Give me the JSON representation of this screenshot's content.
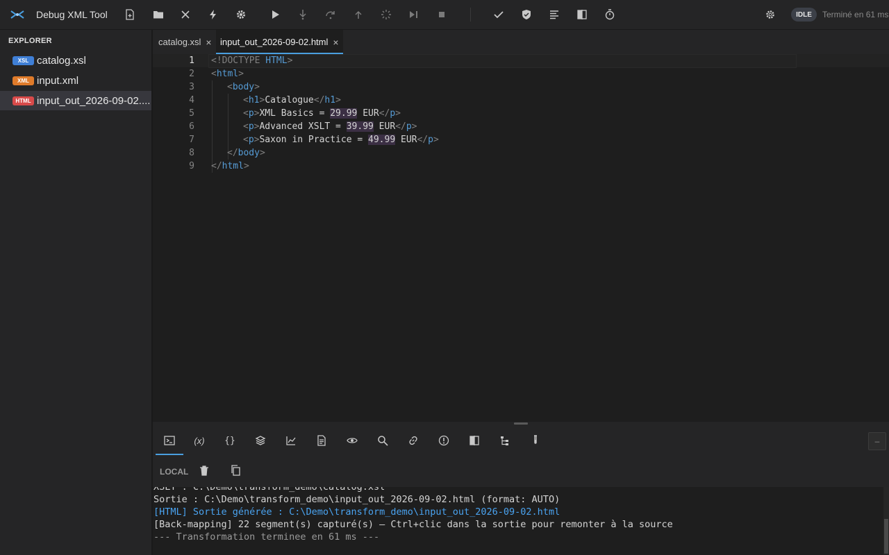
{
  "app": {
    "title": "Debug XML Tool"
  },
  "toolbar": {
    "buttons": [
      "new-file",
      "open-folder",
      "close",
      "run-quick",
      "settings",
      "play",
      "step-into",
      "step-over",
      "step-out",
      "breakpoint",
      "run-to-cursor",
      "stop",
      "validate",
      "shield",
      "format",
      "compare",
      "timer"
    ],
    "status_badge": "IDLE",
    "status_text": "Terminé en 61 ms",
    "accent": "#4a9fe0"
  },
  "sidebar": {
    "title": "EXPLORER",
    "files": [
      {
        "badge": "XSL",
        "badge_color": "#3f7fd6",
        "name": "catalog.xsl"
      },
      {
        "badge": "XML",
        "badge_color": "#e07b2a",
        "name": "input.xml"
      },
      {
        "badge": "HTML",
        "badge_color": "#d84a4a",
        "name": "input_out_2026-09-02...."
      }
    ]
  },
  "tabs": [
    {
      "label": "catalog.xsl",
      "close": "×"
    },
    {
      "label": "input_out_2026-09-02.html",
      "close": "×"
    }
  ],
  "editor": {
    "line_numbers": [
      "1",
      "2",
      "3",
      "4",
      "5",
      "6",
      "7",
      "8",
      "9"
    ],
    "lines": [
      {
        "parts": [
          [
            "<!DOCTYPE ",
            "b"
          ],
          [
            "HTML",
            "t"
          ],
          [
            ">",
            "b"
          ]
        ]
      },
      {
        "parts": [
          [
            "<",
            "b"
          ],
          [
            "html",
            "t"
          ],
          [
            ">",
            "b"
          ]
        ]
      },
      {
        "parts": [
          [
            "<",
            "b"
          ],
          [
            "body",
            "t"
          ],
          [
            ">",
            "b"
          ]
        ]
      },
      {
        "parts": [
          [
            "<",
            "b"
          ],
          [
            "h1",
            "t"
          ],
          [
            ">",
            "b"
          ],
          [
            "Catalogue",
            ""
          ],
          [
            "</",
            "b"
          ],
          [
            "h1",
            "t"
          ],
          [
            ">",
            "b"
          ]
        ]
      },
      {
        "parts": [
          [
            "<",
            "b"
          ],
          [
            "p",
            "t"
          ],
          [
            ">",
            "b"
          ],
          [
            "XML Basics = ",
            ""
          ],
          [
            "29.99",
            "hl"
          ],
          [
            " EUR",
            ""
          ],
          [
            "</",
            "b"
          ],
          [
            "p",
            "t"
          ],
          [
            ">",
            "b"
          ]
        ]
      },
      {
        "parts": [
          [
            "<",
            "b"
          ],
          [
            "p",
            "t"
          ],
          [
            ">",
            "b"
          ],
          [
            "Advanced XSLT = ",
            ""
          ],
          [
            "39.99",
            "hl"
          ],
          [
            " EUR",
            ""
          ],
          [
            "</",
            "b"
          ],
          [
            "p",
            "t"
          ],
          [
            ">",
            "b"
          ]
        ]
      },
      {
        "parts": [
          [
            "<",
            "b"
          ],
          [
            "p",
            "t"
          ],
          [
            ">",
            "b"
          ],
          [
            "Saxon in Practice = ",
            ""
          ],
          [
            "49.99",
            "hl"
          ],
          [
            " EUR",
            ""
          ],
          [
            "</",
            "b"
          ],
          [
            "p",
            "t"
          ],
          [
            ">",
            "b"
          ]
        ]
      },
      {
        "parts": [
          [
            "</",
            "b"
          ],
          [
            "body",
            "t"
          ],
          [
            ">",
            "b"
          ]
        ]
      },
      {
        "parts": [
          [
            "</",
            "b"
          ],
          [
            "html",
            "t"
          ],
          [
            ">",
            "b"
          ]
        ]
      }
    ]
  },
  "panel": {
    "tabs": [
      "console-icon",
      "variables-icon",
      "braces-icon",
      "layers-icon",
      "chart-icon",
      "document-icon",
      "eye-icon",
      "search-icon",
      "link-icon",
      "alert-icon",
      "compare-icon",
      "tree-icon",
      "test-icon"
    ],
    "variables_label": "(x)",
    "braces_label": "{}",
    "minimize": "–"
  },
  "console": {
    "scope_label": "LOCAL",
    "lines": [
      {
        "text": "XSLT : C:\\Demo\\transform_demo\\catalog.xsl",
        "style": ""
      },
      {
        "text": "Sortie : C:\\Demo\\transform_demo\\input_out_2026-09-02.html (format: AUTO)",
        "style": ""
      },
      {
        "text": "[HTML] Sortie générée : C:\\Demo\\transform_demo\\input_out_2026-09-02.html",
        "style": "blue"
      },
      {
        "text": "[Back-mapping] 22 segment(s) capturé(s) — Ctrl+clic dans la sortie pour remonter à la source",
        "style": ""
      },
      {
        "text": "--- Transformation terminee en 61 ms ---",
        "style": "gray"
      }
    ]
  }
}
